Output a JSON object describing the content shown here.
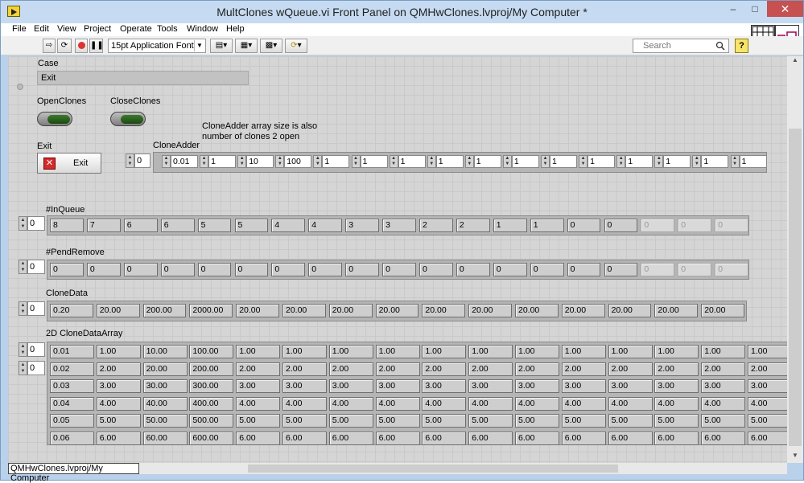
{
  "window": {
    "title": "MultClones wQueue.vi Front Panel on QMHwClones.lvproj/My Computer *"
  },
  "menu": [
    "File",
    "Edit",
    "View",
    "Project",
    "Operate",
    "Tools",
    "Window",
    "Help"
  ],
  "toolbar": {
    "font": "15pt Application Font",
    "search_placeholder": "Search",
    "help": "?"
  },
  "status_bar": "QMHwClones.lvproj/My Computer",
  "panel": {
    "case": {
      "label": "Case",
      "value": "Exit"
    },
    "open_clones": {
      "label": "OpenClones"
    },
    "close_clones": {
      "label": "CloseClones"
    },
    "exit": {
      "label": "Exit",
      "button_text": "Exit"
    },
    "note": [
      "CloneAdder array size is also",
      "number of clones 2 open"
    ],
    "clone_adder": {
      "label": "CloneAdder",
      "index": "0",
      "values": [
        "0.01",
        "1",
        "10",
        "100",
        "1",
        "1",
        "1",
        "1",
        "1",
        "1",
        "1",
        "1",
        "1",
        "1",
        "1",
        "1"
      ]
    },
    "in_queue": {
      "label": "#InQueue",
      "index": "0",
      "values": [
        "8",
        "7",
        "6",
        "6",
        "5",
        "5",
        "4",
        "4",
        "3",
        "3",
        "2",
        "2",
        "1",
        "1",
        "0",
        "0"
      ],
      "dim": [
        "0",
        "0",
        "0"
      ]
    },
    "pend_remove": {
      "label": "#PendRemove",
      "index": "0",
      "values": [
        "0",
        "0",
        "0",
        "0",
        "0",
        "0",
        "0",
        "0",
        "0",
        "0",
        "0",
        "0",
        "0",
        "0",
        "0",
        "0"
      ],
      "dim": [
        "0",
        "0",
        "0"
      ]
    },
    "clone_data": {
      "label": "CloneData",
      "index": "0",
      "values": [
        "0.20",
        "20.00",
        "200.00",
        "2000.00",
        "20.00",
        "20.00",
        "20.00",
        "20.00",
        "20.00",
        "20.00",
        "20.00",
        "20.00",
        "20.00",
        "20.00",
        "20.00"
      ]
    },
    "clone_data_array": {
      "label": "2D CloneDataArray",
      "index_row": "0",
      "index_col": "0",
      "rows": [
        [
          "0.01",
          "1.00",
          "10.00",
          "100.00",
          "1.00",
          "1.00",
          "1.00",
          "1.00",
          "1.00",
          "1.00",
          "1.00",
          "1.00",
          "1.00",
          "1.00",
          "1.00",
          "1.00"
        ],
        [
          "0.02",
          "2.00",
          "20.00",
          "200.00",
          "2.00",
          "2.00",
          "2.00",
          "2.00",
          "2.00",
          "2.00",
          "2.00",
          "2.00",
          "2.00",
          "2.00",
          "2.00",
          "2.00"
        ],
        [
          "0.03",
          "3.00",
          "30.00",
          "300.00",
          "3.00",
          "3.00",
          "3.00",
          "3.00",
          "3.00",
          "3.00",
          "3.00",
          "3.00",
          "3.00",
          "3.00",
          "3.00",
          "3.00"
        ],
        [
          "0.04",
          "4.00",
          "40.00",
          "400.00",
          "4.00",
          "4.00",
          "4.00",
          "4.00",
          "4.00",
          "4.00",
          "4.00",
          "4.00",
          "4.00",
          "4.00",
          "4.00",
          "4.00"
        ],
        [
          "0.05",
          "5.00",
          "50.00",
          "500.00",
          "5.00",
          "5.00",
          "5.00",
          "5.00",
          "5.00",
          "5.00",
          "5.00",
          "5.00",
          "5.00",
          "5.00",
          "5.00",
          "5.00"
        ],
        [
          "0.06",
          "6.00",
          "60.00",
          "600.00",
          "6.00",
          "6.00",
          "6.00",
          "6.00",
          "6.00",
          "6.00",
          "6.00",
          "6.00",
          "6.00",
          "6.00",
          "6.00",
          "6.00"
        ]
      ]
    }
  }
}
